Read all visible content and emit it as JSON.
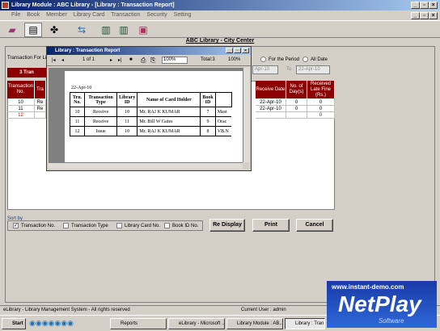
{
  "window": {
    "title": "Library Module : ABC Library - [Library : Transaction Report]",
    "menu": [
      "File",
      "Book",
      "Member",
      "Library Card",
      "Transaction",
      "Security",
      "Setting"
    ]
  },
  "header": {
    "subtitle": "ABC Library - City Center"
  },
  "filter": {
    "label_prefix": "Transaction For Lib",
    "for_period": "For the Period",
    "all_date": "All Date",
    "from_date": "Apr-10",
    "to_label": "To",
    "to_date": "22-Apr-10",
    "count_tab": "3 Tran"
  },
  "grid": {
    "headers": [
      "Transaction No.",
      "Tra",
      "Receive Date",
      "No. of Day(s)",
      "Received Late Fine (Rs.)"
    ],
    "rows": [
      {
        "no": "10",
        "t": "Re",
        "date": "22-Apr-10",
        "days": "0",
        "fine": "0"
      },
      {
        "no": "11",
        "t": "Re",
        "date": "22-Apr-10",
        "days": "0",
        "fine": "0"
      },
      {
        "no": "12",
        "t": "",
        "date": "",
        "days": "",
        "fine": "0"
      }
    ]
  },
  "sort": {
    "label": "Sort by",
    "options": [
      {
        "label": "Transaction No.",
        "checked": true
      },
      {
        "label": "Transaction Type",
        "checked": false
      },
      {
        "label": "Library Card No.",
        "checked": false
      },
      {
        "label": "Book ID No.",
        "checked": false
      }
    ]
  },
  "buttons": {
    "redisplay": "Re Display",
    "print": "Print",
    "cancel": "Cancel"
  },
  "report": {
    "title": "Library : Transaction Report",
    "page": "1 of 1",
    "zoom": "100%",
    "total": "Total:3",
    "pct": "100%",
    "date": "22-Apr-10",
    "headers": [
      "Trn. No.",
      "Transaction Type",
      "Library ID",
      "Name of Card Holder",
      "Book ID",
      ""
    ],
    "rows": [
      [
        "10",
        "Receive",
        "10",
        "Mr. RAJ K KUMAR",
        "7",
        "Mast"
      ],
      [
        "11",
        "Receive",
        "11",
        "Mr. Bill W Gates",
        "9",
        "Orac"
      ],
      [
        "12",
        "Issue",
        "10",
        "Mr. RAJ K KUMAR",
        "8",
        "VB.N"
      ]
    ]
  },
  "status": {
    "left": "eLibrary - Library Management System - All rights reserved",
    "user": "Current User : admin"
  },
  "taskbar": {
    "start": "Start",
    "items": [
      "Reports",
      "eLibrary - Microsoft ...",
      "Library Module : AB...",
      "Library : Tran"
    ]
  },
  "watermark": {
    "url": "www.instant-demo.com",
    "brand": "NetPlay",
    "sub": "Software"
  }
}
